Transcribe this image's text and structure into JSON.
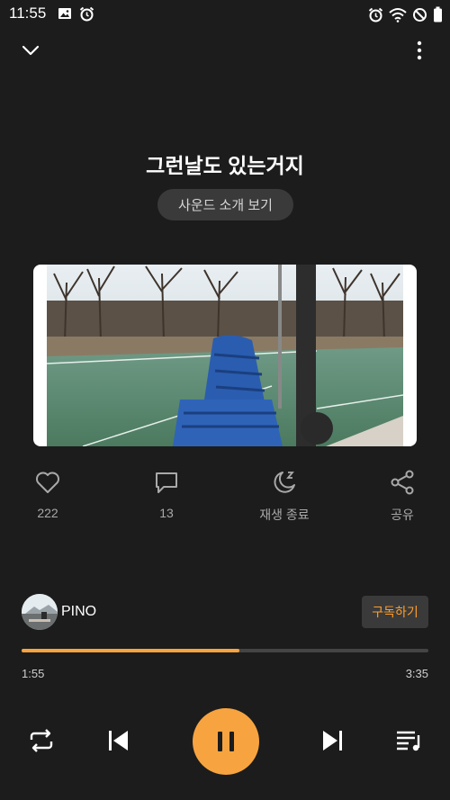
{
  "status_bar": {
    "time": "11:55",
    "left_icons": [
      "image-icon",
      "alarm-icon"
    ],
    "right_icons": [
      "alarm-icon",
      "wifi-icon",
      "do-not-disturb-icon",
      "battery-icon"
    ]
  },
  "nav": {
    "collapse_icon": "chevron-down-icon",
    "more_icon": "more-vertical-icon"
  },
  "song": {
    "title": "그런날도 있는거지",
    "sound_intro_label": "사운드 소개 보기"
  },
  "actions": [
    {
      "icon": "heart-icon",
      "label": "222"
    },
    {
      "icon": "comment-icon",
      "label": "13"
    },
    {
      "icon": "sleep-timer-icon",
      "label": "재생 종료"
    },
    {
      "icon": "share-icon",
      "label": "공유"
    }
  ],
  "channel": {
    "name": "PINO",
    "subscribe_label": "구독하기"
  },
  "progress": {
    "current_time": "1:55",
    "total_time": "3:35",
    "fraction": 0.535
  },
  "controls": {
    "repeat_icon": "repeat-icon",
    "previous_icon": "skip-previous-icon",
    "play_pause_icon": "pause-icon",
    "next_icon": "skip-next-icon",
    "playlist_icon": "playlist-icon"
  },
  "colors": {
    "accent": "#f7a440",
    "background": "#1c1c1c",
    "pill": "#3a3a3a",
    "muted_text": "#a9a9a9"
  }
}
